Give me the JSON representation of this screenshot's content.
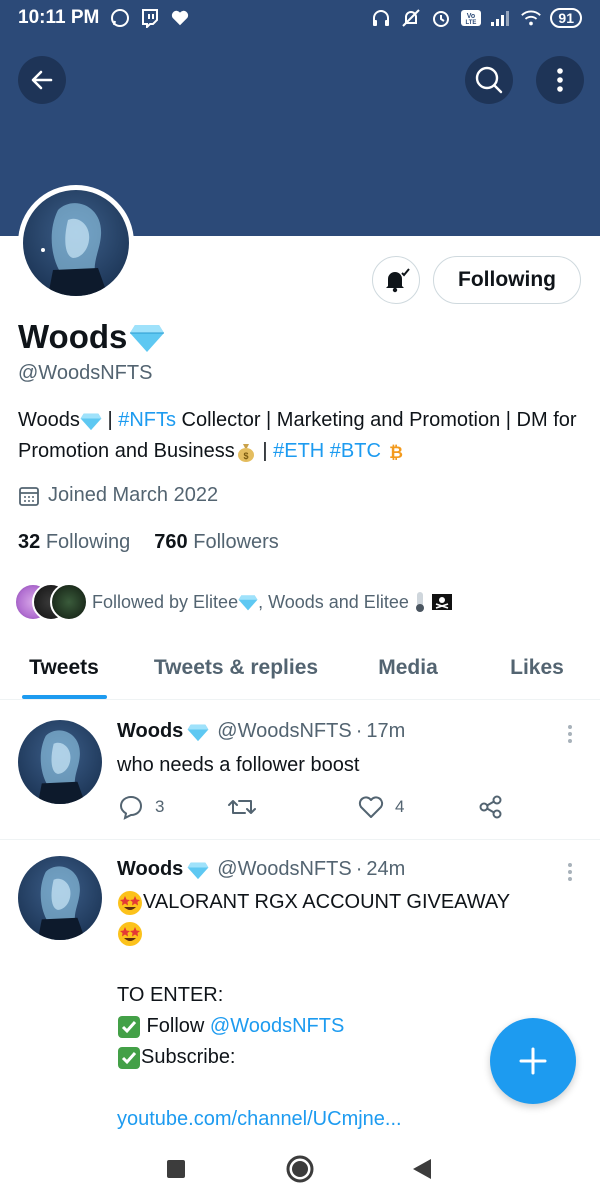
{
  "status_bar": {
    "time": "10:11 PM",
    "battery": "91",
    "icons_left": [
      "whatsapp-icon",
      "twitch-icon",
      "heart-icon"
    ],
    "icons_right": [
      "headphones-icon",
      "mute-bell-icon",
      "alarm-icon",
      "volte-icon",
      "signal-icon",
      "wifi-icon",
      "battery-icon"
    ]
  },
  "header": {
    "back_icon": "arrow-left-icon",
    "search_icon": "search-icon",
    "more_icon": "more-vertical-icon",
    "banner_color": "#2c4a78"
  },
  "profile": {
    "name": "Woods",
    "handle": "@WoodsNFTS",
    "following_button": "Following",
    "bio_parts": {
      "p1": "Woods",
      "p2": " | ",
      "tag_nfts": "#NFTs",
      "p3": " Collector | Marketing and Promotion | DM for Promotion and Business",
      "p4": " | ",
      "tag_eth": "#ETH",
      "p5": " ",
      "tag_btc": "#BTC"
    },
    "joined": "Joined March 2022",
    "following_count": "32",
    "following_label": "Following",
    "followers_count": "760",
    "followers_label": "Followers",
    "followed_by": "Followed by Elitee",
    "followed_by_rest": ", Woods and Elitee"
  },
  "tabs": [
    {
      "label": "Tweets",
      "active": true
    },
    {
      "label": "Tweets & replies",
      "active": false
    },
    {
      "label": "Media",
      "active": false
    },
    {
      "label": "Likes",
      "active": false
    }
  ],
  "tweets": [
    {
      "name": "Woods",
      "handle": "@WoodsNFTS",
      "sep": "·",
      "time": "17m",
      "text": "who needs a follower boost",
      "replies": "3",
      "retweets": "",
      "likes": "4"
    },
    {
      "name": "Woods",
      "handle": "@WoodsNFTS",
      "sep": "·",
      "time": "24m",
      "line1": "VALORANT RGX ACCOUNT GIVEAWAY",
      "line_enter": "TO ENTER:",
      "follow_word": " Follow ",
      "follow_mention": "@WoodsNFTS",
      "subscribe": "Subscribe:",
      "link": "youtube.com/channel/UCmjne..."
    }
  ],
  "colors": {
    "accent": "#1d9bf0",
    "text_primary": "#0f1419",
    "text_secondary": "#536471",
    "verified_diamond": "#5ec8f2"
  }
}
